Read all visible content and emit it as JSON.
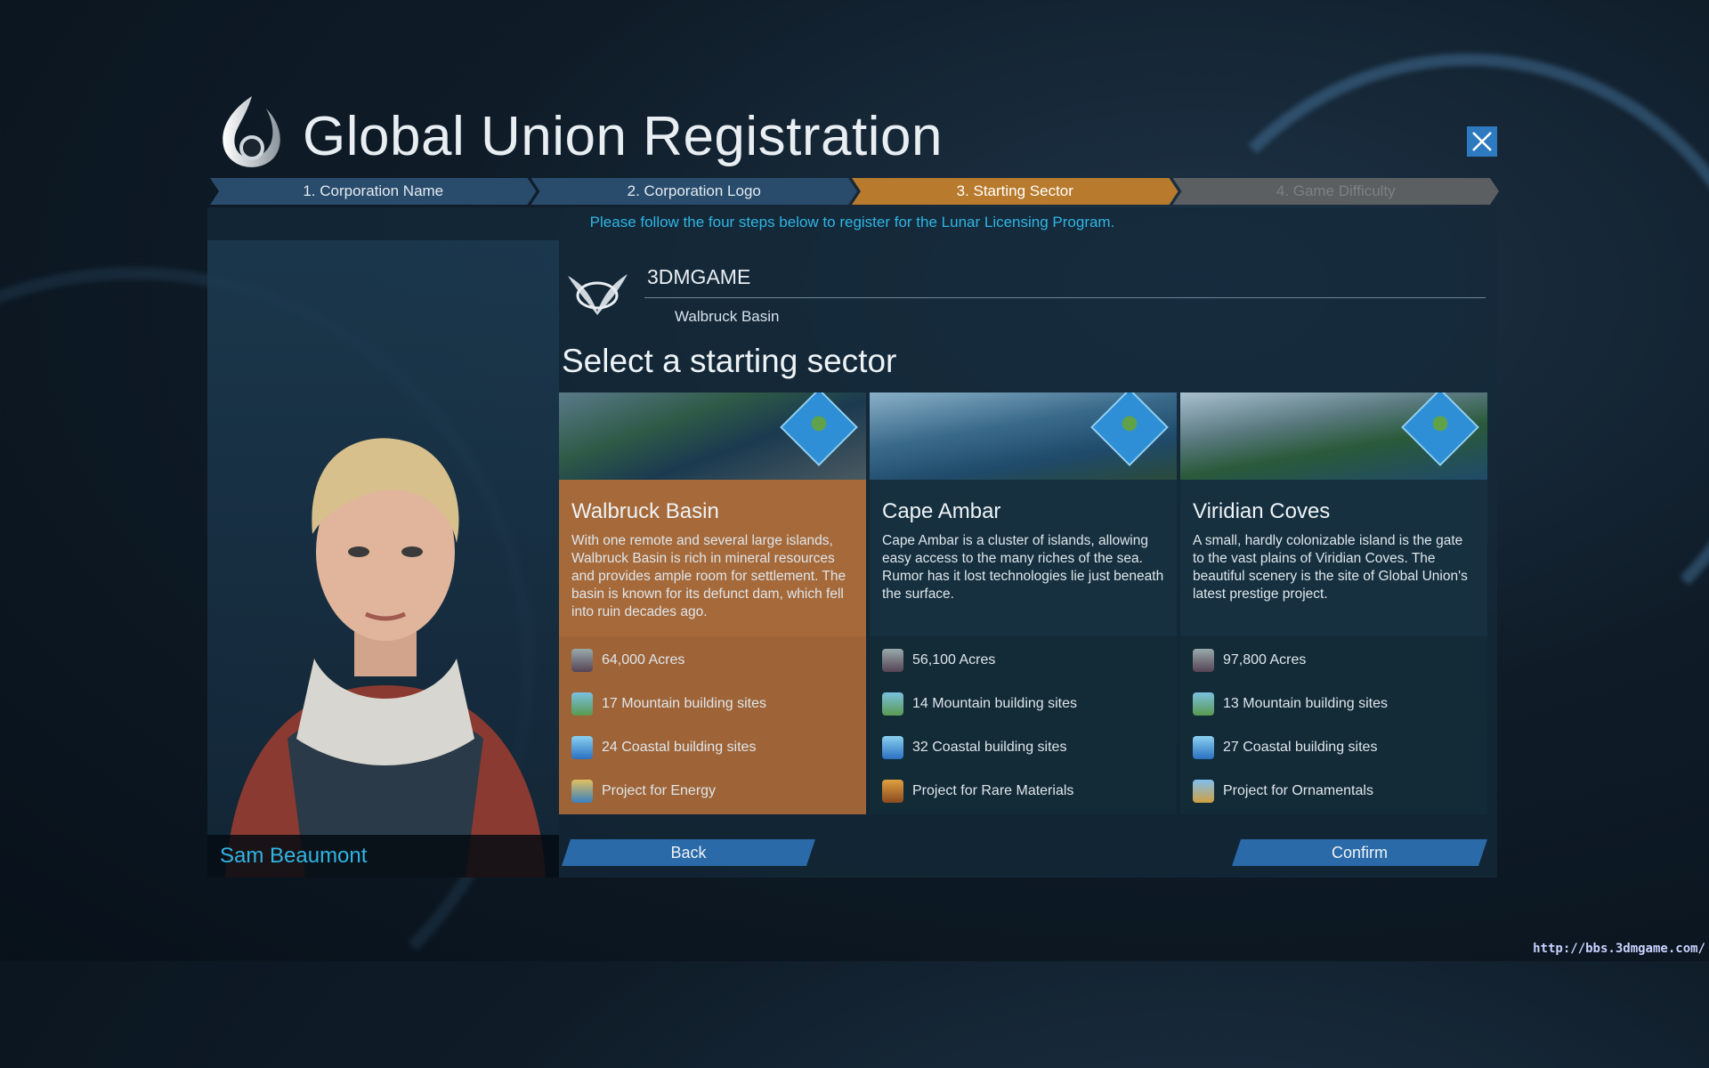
{
  "header": {
    "title": "Global Union Registration",
    "close_icon": "close-icon"
  },
  "steps": [
    {
      "label": "1. Corporation Name",
      "state": "done"
    },
    {
      "label": "2. Corporation Logo",
      "state": "done"
    },
    {
      "label": "3. Starting Sector",
      "state": "active"
    },
    {
      "label": "4. Game Difficulty",
      "state": "disabled"
    }
  ],
  "instruction": "Please follow the four steps below to register for the Lunar Licensing Program.",
  "corporation": {
    "name": "3DMGAME",
    "sector": "Walbruck Basin"
  },
  "advisor": {
    "name": "Sam Beaumont"
  },
  "heading": "Select a starting sector",
  "sectors": [
    {
      "name": "Walbruck Basin",
      "selected": true,
      "description": "With one remote and several large islands, Walbruck Basin is rich in mineral resources and provides ample room for settlement. The basin is known for its defunct dam, which fell into ruin decades ago.",
      "acres": "64,000 Acres",
      "mountain": "17 Mountain building sites",
      "coastal": "24 Coastal building sites",
      "project": "Project for Energy"
    },
    {
      "name": "Cape Ambar",
      "selected": false,
      "description": "Cape Ambar is a cluster of islands, allowing easy access to the many riches of the sea. Rumor has it lost technologies lie just beneath the surface.",
      "acres": "56,100 Acres",
      "mountain": "14 Mountain building sites",
      "coastal": "32 Coastal building sites",
      "project": "Project for Rare Materials"
    },
    {
      "name": "Viridian Coves",
      "selected": false,
      "description": "A small, hardly colonizable island is the gate to the vast plains of Viridian Coves. The beautiful scenery is the site of Global Union's latest prestige project.",
      "acres": "97,800 Acres",
      "mountain": "13 Mountain building sites",
      "coastal": "27 Coastal building sites",
      "project": "Project for Ornamentals"
    }
  ],
  "buttons": {
    "back": "Back",
    "confirm": "Confirm"
  },
  "watermark": "http://bbs.3dmgame.com/",
  "colors": {
    "accent": "#2fb5e4",
    "selected": "#a5693a",
    "step_active": "#b87a2c",
    "button": "#2a6aa8"
  }
}
